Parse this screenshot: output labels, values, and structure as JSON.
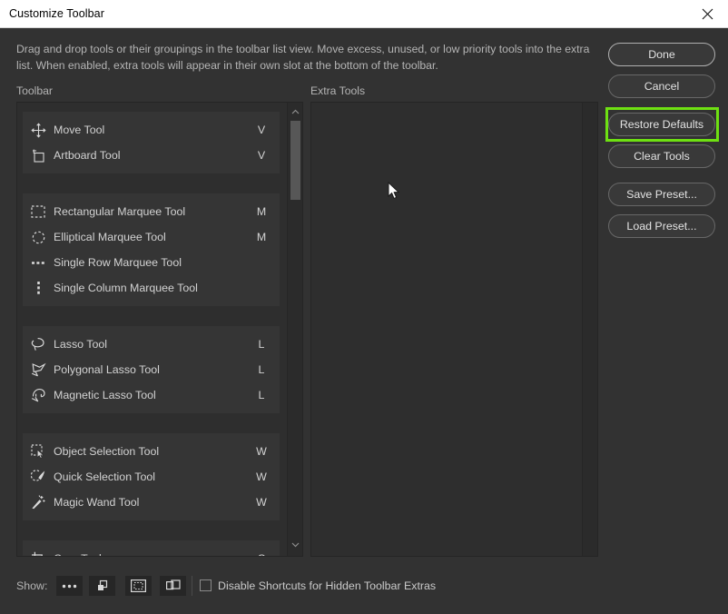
{
  "window": {
    "title": "Customize Toolbar",
    "close_icon": "close-icon"
  },
  "description": "Drag and drop tools or their groupings in the toolbar list view. Move excess, unused, or low priority tools into the extra list. When enabled, extra tools will appear in their own slot at the bottom of the toolbar.",
  "columns": {
    "toolbar_label": "Toolbar",
    "extra_label": "Extra Tools"
  },
  "toolbar_groups": [
    {
      "tools": [
        {
          "name": "Move Tool",
          "key": "V",
          "icon": "move-tool-icon"
        },
        {
          "name": "Artboard Tool",
          "key": "V",
          "icon": "artboard-tool-icon"
        }
      ]
    },
    {
      "tools": [
        {
          "name": "Rectangular Marquee Tool",
          "key": "M",
          "icon": "rectangular-marquee-tool-icon"
        },
        {
          "name": "Elliptical Marquee Tool",
          "key": "M",
          "icon": "elliptical-marquee-tool-icon"
        },
        {
          "name": "Single Row Marquee Tool",
          "key": "",
          "icon": "single-row-marquee-tool-icon"
        },
        {
          "name": "Single Column Marquee Tool",
          "key": "",
          "icon": "single-column-marquee-tool-icon"
        }
      ]
    },
    {
      "tools": [
        {
          "name": "Lasso Tool",
          "key": "L",
          "icon": "lasso-tool-icon"
        },
        {
          "name": "Polygonal Lasso Tool",
          "key": "L",
          "icon": "polygonal-lasso-tool-icon"
        },
        {
          "name": "Magnetic Lasso Tool",
          "key": "L",
          "icon": "magnetic-lasso-tool-icon"
        }
      ]
    },
    {
      "tools": [
        {
          "name": "Object Selection Tool",
          "key": "W",
          "icon": "object-selection-tool-icon"
        },
        {
          "name": "Quick Selection Tool",
          "key": "W",
          "icon": "quick-selection-tool-icon"
        },
        {
          "name": "Magic Wand Tool",
          "key": "W",
          "icon": "magic-wand-tool-icon"
        }
      ]
    },
    {
      "tools": [
        {
          "name": "Crop Tool",
          "key": "C",
          "icon": "crop-tool-icon"
        }
      ]
    }
  ],
  "buttons": {
    "done": "Done",
    "cancel": "Cancel",
    "restore_defaults": "Restore Defaults",
    "clear_tools": "Clear Tools",
    "save_preset": "Save Preset...",
    "load_preset": "Load Preset..."
  },
  "highlight": {
    "target": "Restore Defaults",
    "color": "#6ee012"
  },
  "bottom_bar": {
    "show_label": "Show:",
    "show_buttons": [
      {
        "icon": "ellipsis-icon"
      },
      {
        "icon": "overlapping-squares-icon"
      },
      {
        "icon": "dotted-selection-icon"
      },
      {
        "icon": "overlapping-windows-icon"
      }
    ],
    "checkbox_label": "Disable Shortcuts for Hidden Toolbar Extras",
    "checkbox_checked": false
  },
  "colors": {
    "dialog_bg": "#323232",
    "panel_bg": "#2e2e2e",
    "group_bg": "#353535",
    "titlebar_bg": "#ffffff",
    "highlight_green": "#6ee012"
  }
}
